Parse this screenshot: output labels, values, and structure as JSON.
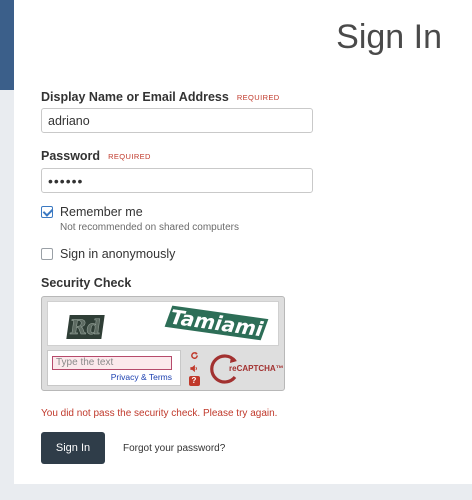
{
  "page": {
    "title": "Sign In"
  },
  "login": {
    "label": "Display Name or Email Address",
    "required": "REQUIRED",
    "value": "adriano"
  },
  "password": {
    "label": "Password",
    "required": "REQUIRED",
    "value": "••••••"
  },
  "remember": {
    "label": "Remember me",
    "hint": "Not recommended on shared computers",
    "checked": true
  },
  "anonymous": {
    "label": "Sign in anonymously",
    "checked": false
  },
  "security": {
    "title": "Security Check",
    "captcha_words": [
      "Rd",
      "Tamiami"
    ],
    "input_placeholder": "Type the text",
    "privacy_terms": "Privacy & Terms",
    "brand": "reCAPTCHA™",
    "icons": [
      "refresh-icon",
      "audio-icon",
      "help-icon"
    ]
  },
  "error": "You did not pass the security check. Please try again.",
  "actions": {
    "signin_label": "Sign In",
    "forgot_label": "Forgot your password?"
  },
  "colors": {
    "accent": "#3b5f8a",
    "button": "#2f3d49",
    "error": "#c0392b"
  }
}
